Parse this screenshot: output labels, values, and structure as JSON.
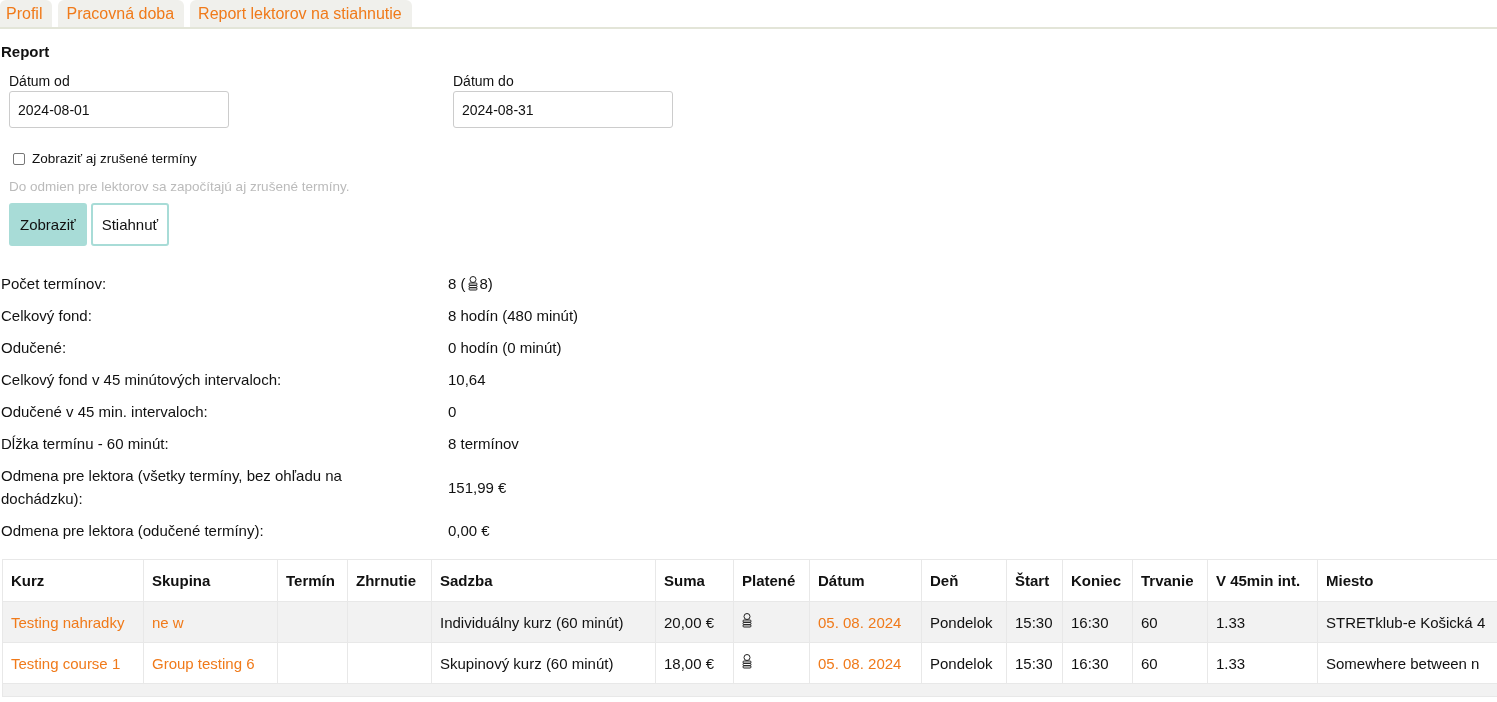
{
  "tabs": [
    {
      "label": "Profil"
    },
    {
      "label": "Pracovná doba"
    },
    {
      "label": "Report lektorov na stiahnutie"
    }
  ],
  "heading": "Report",
  "date_from": {
    "label": "Dátum od",
    "value": "2024-08-01"
  },
  "date_to": {
    "label": "Dátum do",
    "value": "2024-08-31"
  },
  "show_cancelled": {
    "label": "Zobraziť aj zrušené termíny",
    "checked": false
  },
  "hint": "Do odmien pre lektorov sa započítajú aj zrušené termíny.",
  "buttons": [
    {
      "label": "Zobraziť",
      "kind": "primary"
    },
    {
      "label": "Stiahnuť",
      "kind": "outline"
    }
  ],
  "stats": [
    {
      "label": "Počet termínov:",
      "value": "8 (",
      "paid_icon": true,
      "value_after": "8)"
    },
    {
      "label": "Celkový fond:",
      "value": "8 hodín (480 minút)"
    },
    {
      "label": "Odučené:",
      "value": "0 hodín (0 minút)"
    },
    {
      "label": "Celkový fond v 45 minútových intervaloch:",
      "value": "10,64"
    },
    {
      "label": "Odučené v 45 min. intervaloch:",
      "value": "0"
    },
    {
      "label": "Dĺžka termínu - 60 minút:",
      "value": "8 termínov"
    },
    {
      "label": "Odmena pre lektora (všetky termíny, bez ohľadu na dochádzku):",
      "value": "151,99 €"
    },
    {
      "label": "Odmena pre lektora (odučené termíny):",
      "value": "0,00 €"
    }
  ],
  "table": {
    "columns": [
      "Kurz",
      "Skupina",
      "Termín",
      "Zhrnutie",
      "Sadzba",
      "Suma",
      "Platené",
      "Dátum",
      "Deň",
      "Štart",
      "Koniec",
      "Trvanie",
      "V 45min int.",
      "Miesto"
    ],
    "rows": [
      {
        "course": "Testing nahradky",
        "group": "ne w",
        "rate": "Individuálny kurz (60 minút)",
        "sum": "20,00 €",
        "paid": true,
        "date": "05. 08. 2024",
        "day": "Pondelok",
        "start": "15:30",
        "end": "16:30",
        "duration": "60",
        "intervals": "1.33",
        "place": "STRETklub-e Košická 4"
      },
      {
        "course": "Testing course 1",
        "group": "Group testing 6",
        "rate": "Skupinový kurz (60 minút)",
        "sum": "18,00 €",
        "paid": true,
        "date": "05. 08. 2024",
        "day": "Pondelok",
        "start": "15:30",
        "end": "16:30",
        "duration": "60",
        "intervals": "1.33",
        "place": "Somewhere between n"
      }
    ]
  }
}
